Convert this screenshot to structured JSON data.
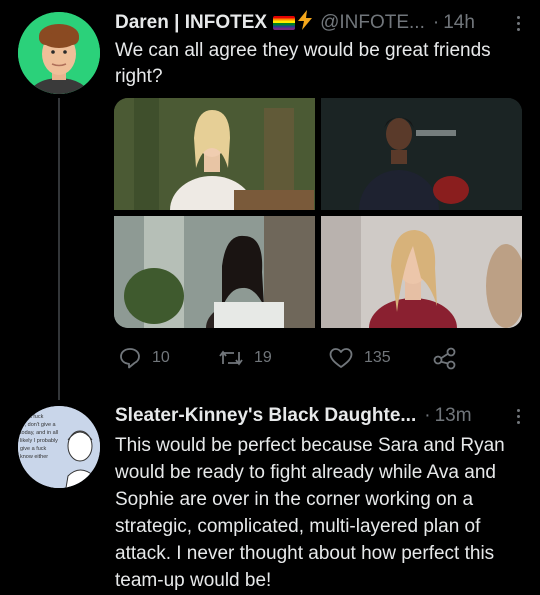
{
  "tweet1": {
    "display_name": "Daren | INFOTEX",
    "handle": "@INFOTE...",
    "separator": "·",
    "time": "14h",
    "text": "We can all agree they would be great friends right?",
    "actions": {
      "reply_count": "10",
      "retweet_count": "19",
      "like_count": "135"
    }
  },
  "tweet2": {
    "display_name": "Sleater-Kinney's Black Daughte...",
    "separator": "·",
    "time": "13m",
    "text": "This would be perfect because Sara and Ryan would be ready to fight already while Ava and Sophie are over in the corner working on a strategic, complicated, multi-layered plan of attack. I never thought about how perfect this team-up would be!",
    "avatar_text": "I'm a fuck ..., don't give a ... today, and in all ... likely I probably ... give a fuck ... know either"
  },
  "colors": {
    "background": "#000000",
    "text": "#e7e9ea",
    "muted": "#71767b",
    "avatar1_bg": "#2bd17a",
    "avatar2_bg": "#c9d6ea"
  },
  "icons": [
    "more-icon",
    "pride-flag-icon",
    "lightning-icon",
    "reply-icon",
    "retweet-icon",
    "like-icon",
    "share-icon"
  ]
}
